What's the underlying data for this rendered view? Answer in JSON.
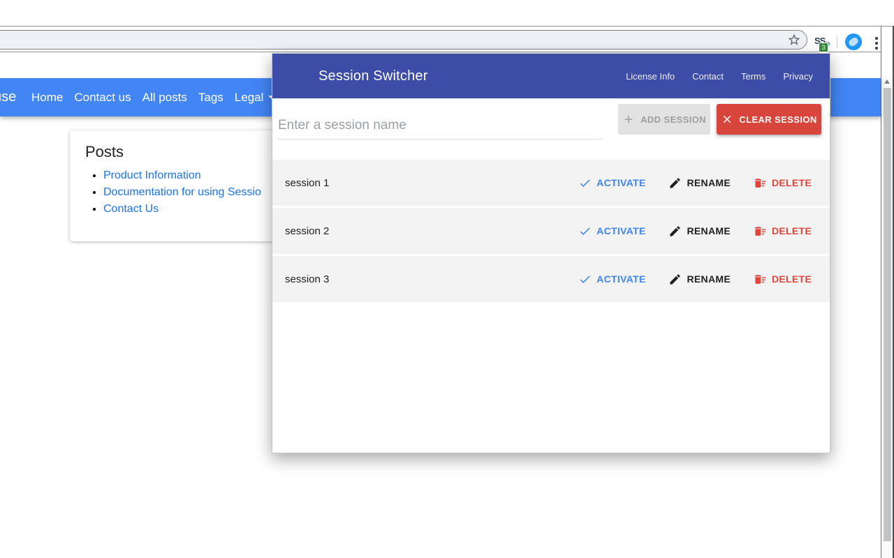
{
  "browser": {
    "extension_initials": "SS",
    "extension_badge_count": "3"
  },
  "site": {
    "brand_fragment": "use",
    "nav_items": [
      "Home",
      "Contact us",
      "All posts",
      "Tags",
      "Legal"
    ],
    "posts": {
      "title": "Posts",
      "links": [
        "Product Information",
        "Documentation for using Sessio",
        "Contact Us"
      ]
    }
  },
  "popup": {
    "title": "Session Switcher",
    "links": [
      "License Info",
      "Contact",
      "Terms",
      "Privacy"
    ],
    "input_placeholder": "Enter a session name",
    "add_label": "ADD SESSION",
    "clear_label": "CLEAR SESSION",
    "sessions": [
      "session 1",
      "session 2",
      "session 3"
    ],
    "action_activate": "ACTIVATE",
    "action_rename": "RENAME",
    "action_delete": "DELETE"
  },
  "colors": {
    "navbar_blue": "#4285f4",
    "popup_header_indigo": "#3d4ca6",
    "activate_blue": "#3d85f0",
    "delete_red": "#e0453c",
    "clear_button_red": "#d8453c",
    "link_blue": "#1a73e8",
    "badge_green": "#388e3c"
  }
}
